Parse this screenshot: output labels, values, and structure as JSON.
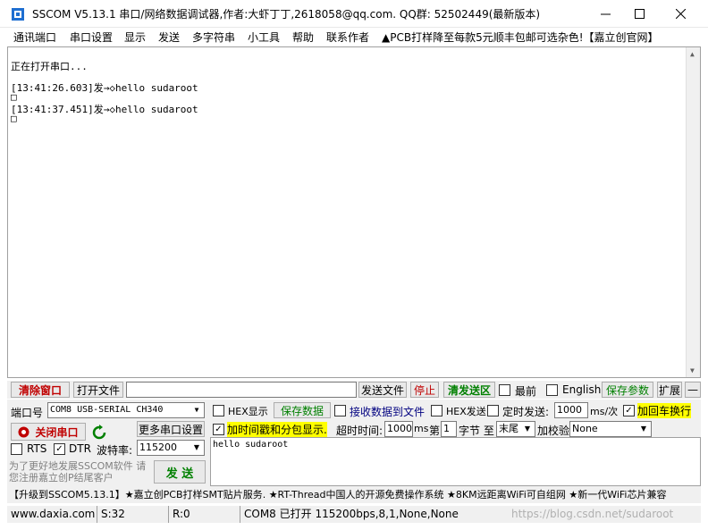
{
  "window": {
    "title": "SSCOM V5.13.1 串口/网络数据调试器,作者:大虾丁丁,2618058@qq.com. QQ群: 52502449(最新版本)"
  },
  "menu": [
    "通讯端口",
    "串口设置",
    "显示",
    "发送",
    "多字符串",
    "小工具",
    "帮助",
    "联系作者",
    "▲PCB打样降至每款5元顺丰包邮可选杂色!【嘉立创官网】"
  ],
  "receive": {
    "lines": [
      "正在打开串口...",
      "[13:41:26.603]发→◇hello sudaroot",
      "□",
      "[13:41:37.451]发→◇hello sudaroot",
      "□"
    ]
  },
  "toolbar": {
    "clear_window": "清除窗口",
    "open_file": "打开文件",
    "send_file": "发送文件",
    "stop": "停止",
    "clear_send": "清发送区",
    "topmost": "最前",
    "english": "English",
    "save_params": "保存参数",
    "expand": "扩展",
    "collapse": "—"
  },
  "port": {
    "port_label": "端口号",
    "port_value": "COM8 USB-SERIAL CH340",
    "more_settings": "更多串口设置",
    "close_port": "关闭串口",
    "rts": "RTS",
    "dtr": "DTR",
    "baud_label": "波特率:",
    "baud_value": "115200",
    "promo": "为了更好地发展SSCOM软件 请您注册嘉立创P结尾客户",
    "send": "发 送"
  },
  "options": {
    "hex_display": "HEX显示",
    "save_data": "保存数据",
    "recv_to_file": "接收数据到文件",
    "hex_send": "HEX发送",
    "timed_send": "定时发送:",
    "interval": "1000",
    "interval_unit": "ms/次",
    "add_crlf": "加回车换行",
    "timestamp": "加时间戳和分包显示.",
    "timeout_label": "超时时间:",
    "timeout_value": "1000",
    "timeout_unit": "ms",
    "byte_label_a": "第",
    "byte_from": "1",
    "byte_label_b": "字节 至",
    "byte_to": "末尾",
    "checksum_label": "加校验",
    "checksum_value": "None"
  },
  "send_area": {
    "text": "hello sudaroot"
  },
  "ticker": "【升级到SSCOM5.13.1】★嘉立创PCB打样SMT贴片服务. ★RT-Thread中国人的开源免费操作系统 ★8KM远距离WiFi可自组网 ★新一代WiFi芯片兼容",
  "status": {
    "site": "www.daxia.com",
    "sent": "S:32",
    "recv": "R:0",
    "port_state": "COM8 已打开  115200bps,8,1,None,None",
    "watermark": "https://blog.csdn.net/sudaroot"
  }
}
